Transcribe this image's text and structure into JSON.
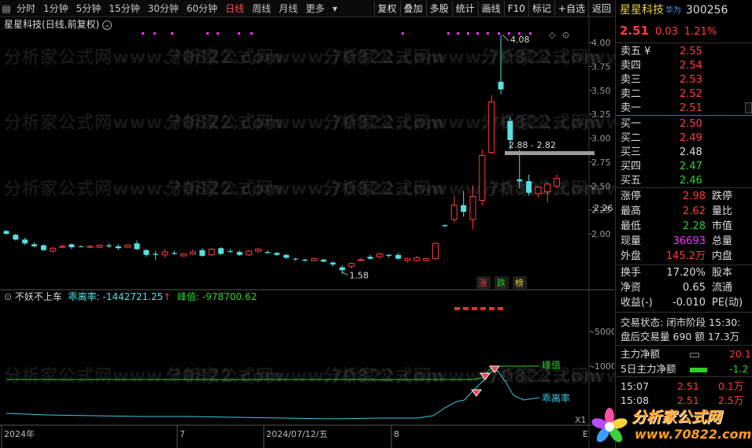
{
  "toolbar": {
    "period_tabs": [
      "分时",
      "1分钟",
      "5分钟",
      "15分钟",
      "30分钟",
      "60分钟",
      "日线",
      "周线",
      "月线",
      "更多"
    ],
    "active_tab": "日线",
    "right_buttons": [
      "复权",
      "叠加",
      "多股",
      "统计",
      "画线",
      "F10",
      "标记",
      "+自选",
      "返回"
    ]
  },
  "chart": {
    "title": "星星科技(日线,前复权)",
    "y_ticks": [
      "4.00",
      "3.75",
      "3.50",
      "3.25",
      "3.00",
      "2.75",
      "2.50",
      "2.25",
      "2.00"
    ],
    "price_tag": "2.26",
    "high_label": "4.08",
    "low_label": "1.58",
    "range_label": "2.88 - 2.82",
    "signals": [
      "涨",
      "跌",
      "榜"
    ]
  },
  "indicator": {
    "name": "不妖不上车",
    "deviation_label": "乖离率:",
    "deviation_value": "-1442721.25",
    "peak_label": "峰值:",
    "peak_value": "-978700.62",
    "y_ticks": [
      "-5000",
      "-10000"
    ],
    "line_label_peak": "峰值",
    "line_label_dev": "乖离率",
    "x1_label": "X1"
  },
  "xaxis": {
    "labels": [
      "2024年",
      "7",
      "2024/07/12/五",
      "8"
    ],
    "end_marker": "E"
  },
  "stock": {
    "name": "星星科技",
    "tag": "华为",
    "code": "300256",
    "price": "2.51",
    "change": "0.03",
    "pct": "1.21%"
  },
  "order_book": {
    "asks": [
      {
        "label": "卖五 ¥",
        "price": "2.55"
      },
      {
        "label": "卖四",
        "price": "2.54"
      },
      {
        "label": "卖三",
        "price": "2.53"
      },
      {
        "label": "卖二",
        "price": "2.52"
      },
      {
        "label": "卖一",
        "price": "2.51"
      }
    ],
    "bids": [
      {
        "label": "买一",
        "price": "2.50",
        "c": "red"
      },
      {
        "label": "买二",
        "price": "2.49",
        "c": "red"
      },
      {
        "label": "买三",
        "price": "2.48",
        "c": "white"
      },
      {
        "label": "买四",
        "price": "2.47",
        "c": "green"
      },
      {
        "label": "买五",
        "price": "2.46",
        "c": "green"
      }
    ]
  },
  "stats": [
    {
      "l": "涨停",
      "v": "2.98",
      "c": "red",
      "r": "跌停"
    },
    {
      "l": "最高",
      "v": "2.62",
      "c": "red",
      "r": "量比"
    },
    {
      "l": "最低",
      "v": "2.28",
      "c": "green",
      "r": "市值"
    },
    {
      "l": "现量",
      "v": "36693",
      "c": "magenta",
      "r": "总量"
    },
    {
      "l": "外盘",
      "v": "145.2万",
      "c": "red",
      "r": "内盘"
    }
  ],
  "stats2": [
    {
      "l": "换手",
      "v": "17.20%",
      "c": "white",
      "r": "股本"
    },
    {
      "l": "净资",
      "v": "0.65",
      "c": "white",
      "r": "流通"
    },
    {
      "l": "收益(-)",
      "v": "-0.010",
      "c": "white",
      "r": "PE(动)"
    }
  ],
  "trade_status": {
    "label": "交易状态:",
    "value": "闭市阶段",
    "time": "15:30:"
  },
  "after_hours": {
    "label": "盘后交易量",
    "vol": "690",
    "amt_label": "额",
    "amt": "17.3万"
  },
  "fund": [
    {
      "label": "主力净额",
      "value": "20.1"
    },
    {
      "label": "5日主力净额",
      "value": "-1.2"
    }
  ],
  "ticks": [
    {
      "t": "15:07",
      "p": "2.51",
      "v": "0.1万"
    },
    {
      "t": "15:08",
      "p": "2.51",
      "v": "2.5万"
    }
  ],
  "watermark": "分析家公式网www.70822.com",
  "logo": {
    "text": "分析家公式网",
    "url": "www.70822.com"
  },
  "colors": {
    "up": "#ff3c3c",
    "down": "#56e0e0",
    "ma": "#2bd02b",
    "dev": "#3cc7e0"
  }
}
